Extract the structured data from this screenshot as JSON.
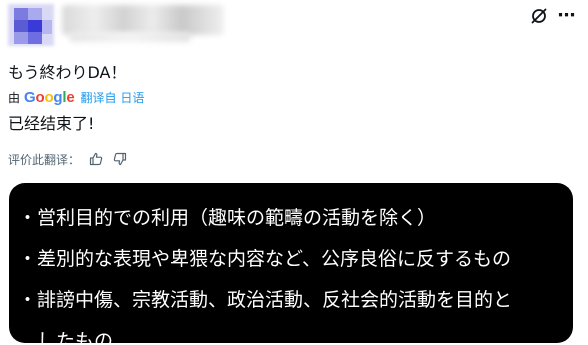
{
  "post": {
    "original_text": "もう終わりDA！",
    "translate_by": "由",
    "translate_engine": "Google",
    "translated_from": "翻译自 日语",
    "translated_text": "已经结束了!",
    "rate_label": "评价此翻译：",
    "icons": {
      "grok": "grok-slash-icon",
      "more": "more-horizontal-icon",
      "thumbs_up": "thumbs-up-icon",
      "thumbs_down": "thumbs-down-icon"
    },
    "more_glyph": "⋯"
  },
  "media": {
    "lines": [
      "・営利目的での利用（趣味の範疇の活動を除く）",
      "・差別的な表現や卑猥な内容など、公序良俗に反するもの",
      "・誹謗中傷、宗教活動、政治活動、反社会的活動を目的と",
      "　したもの"
    ]
  },
  "colors": {
    "link": "#1d9bf0",
    "text": "#0f1419",
    "muted": "#536471",
    "google_blue": "#4285F4",
    "google_red": "#EA4335",
    "google_yellow": "#FBBC05",
    "google_green": "#34A853"
  }
}
